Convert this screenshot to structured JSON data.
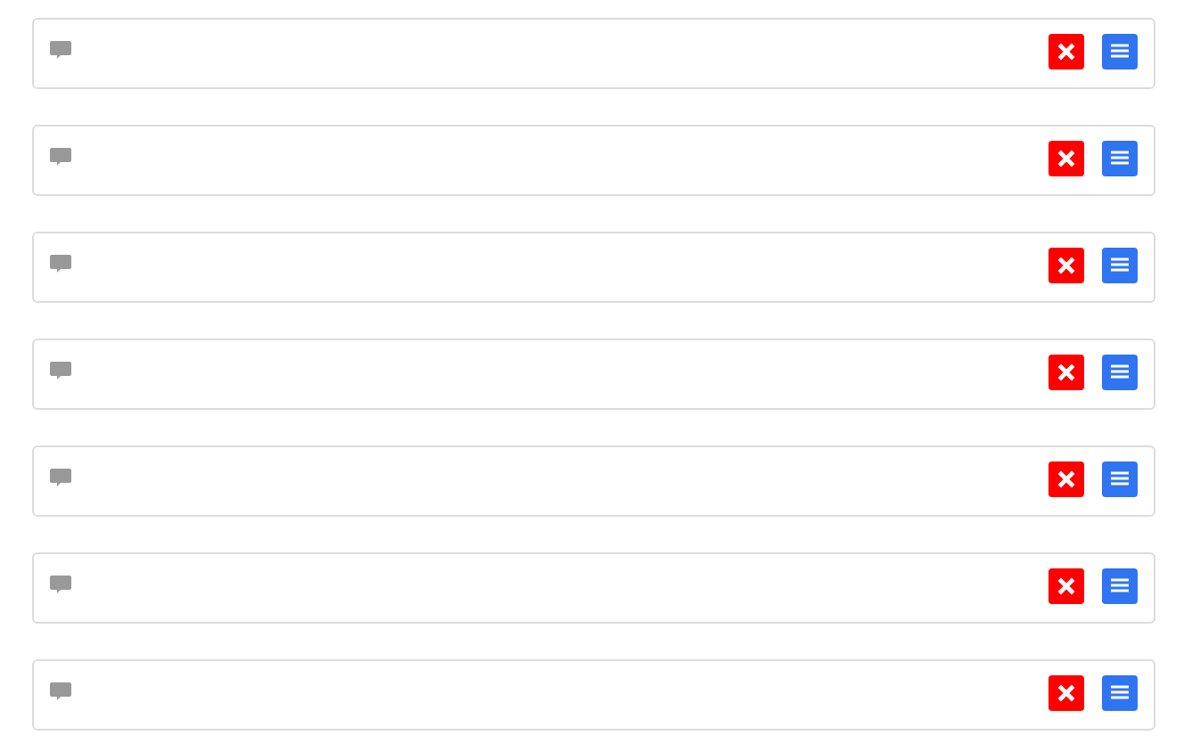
{
  "rows": [
    {
      "kind": "comment"
    },
    {
      "kind": "comment"
    },
    {
      "kind": "comment"
    },
    {
      "kind": "comment"
    },
    {
      "kind": "comment"
    },
    {
      "kind": "comment"
    },
    {
      "kind": "comment"
    }
  ]
}
